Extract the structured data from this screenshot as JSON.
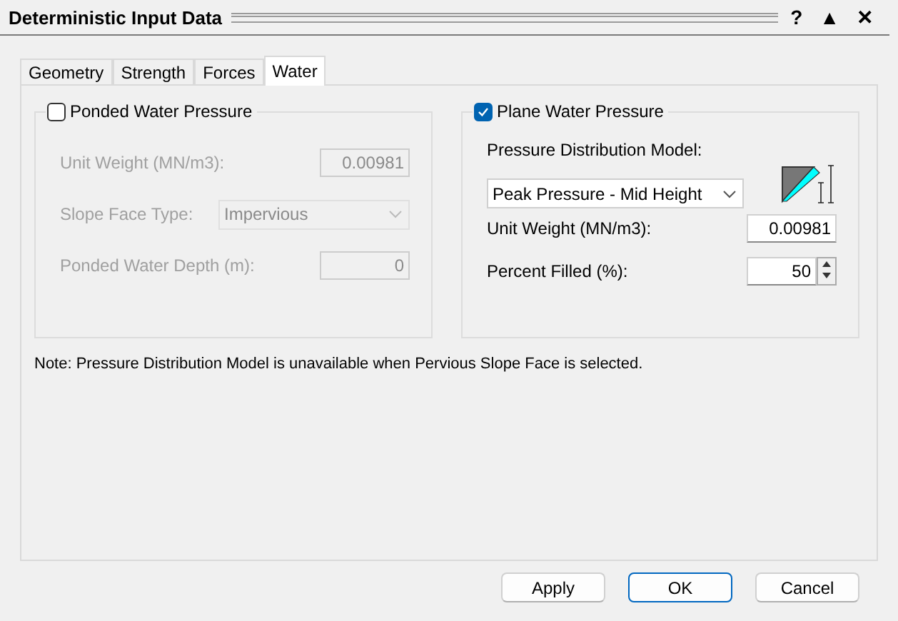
{
  "window": {
    "title": "Deterministic Input Data",
    "controls": [
      "?",
      "▲",
      "✕"
    ]
  },
  "tabs": [
    {
      "label": "Geometry",
      "selected": false
    },
    {
      "label": "Strength",
      "selected": false
    },
    {
      "label": "Forces",
      "selected": false
    },
    {
      "label": "Water",
      "selected": true
    }
  ],
  "ponded": {
    "label": "Ponded Water Pressure",
    "checked": false,
    "fields": [
      {
        "kind": "input",
        "label": "Unit Weight (MN/m3):",
        "value": "0.00981"
      },
      {
        "kind": "select",
        "label": "Slope Face Type:",
        "value": "Impervious"
      },
      {
        "kind": "input",
        "label": "Ponded Water Depth (m):",
        "value": "0"
      }
    ]
  },
  "plane": {
    "label": "Plane Water Pressure",
    "checked": true,
    "model_label": "Pressure Distribution Model:",
    "model_value": "Peak Pressure - Mid Height",
    "fields": [
      {
        "kind": "input",
        "label": "Unit Weight (MN/m3):",
        "value": "0.00981"
      },
      {
        "kind": "spin",
        "label": "Percent Filled (%):",
        "value": "50"
      }
    ]
  },
  "note": "Note: Pressure Distribution Model is unavailable when Pervious Slope Face is selected.",
  "buttons": [
    {
      "label": "Apply",
      "default": false
    },
    {
      "label": "OK",
      "default": true
    },
    {
      "label": "Cancel",
      "default": false
    }
  ]
}
